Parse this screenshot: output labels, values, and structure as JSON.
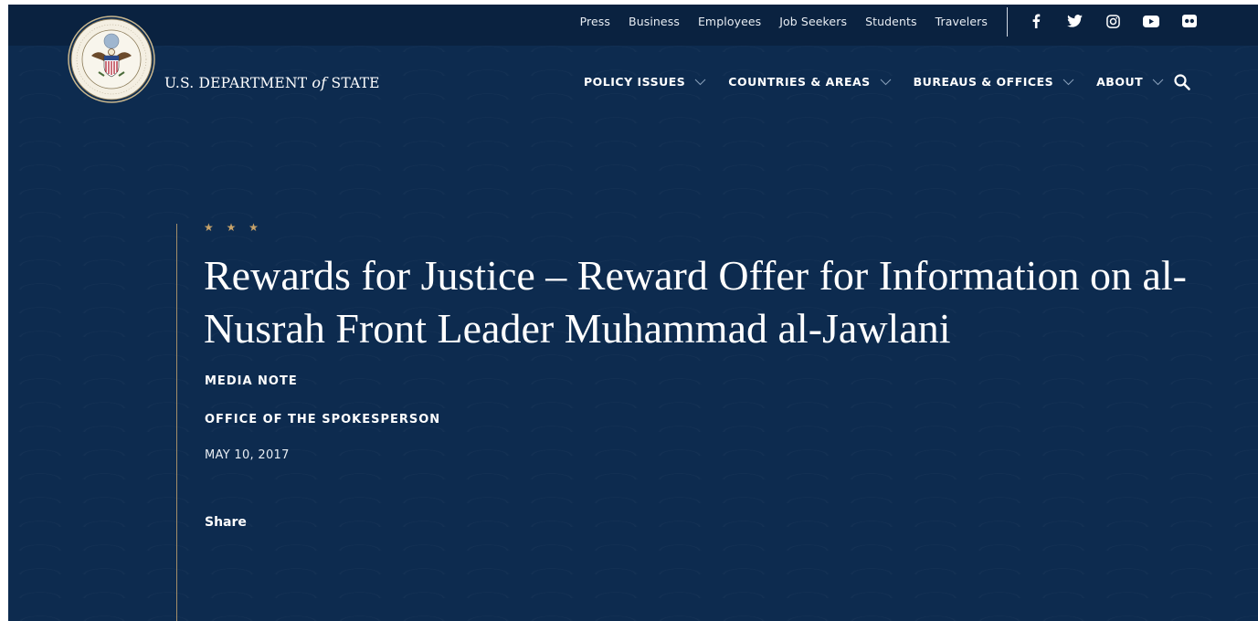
{
  "header": {
    "utility_links": [
      {
        "label": "Press"
      },
      {
        "label": "Business"
      },
      {
        "label": "Employees"
      },
      {
        "label": "Job Seekers"
      },
      {
        "label": "Students"
      },
      {
        "label": "Travelers"
      }
    ],
    "social_icons": [
      "facebook-icon",
      "twitter-icon",
      "instagram-icon",
      "youtube-icon",
      "flickr-icon"
    ],
    "seal_text": "DEPARTMENT OF STATE · UNITED STATES OF AMERICA",
    "wordmark": {
      "pre": "U.S. DEPARTMENT",
      "of": "of",
      "post": "STATE"
    },
    "nav": [
      {
        "label": "POLICY ISSUES"
      },
      {
        "label": "COUNTRIES & AREAS"
      },
      {
        "label": "BUREAUS & OFFICES"
      },
      {
        "label": "ABOUT"
      }
    ],
    "search_icon": "search-icon"
  },
  "article": {
    "stars": "★ ★ ★",
    "title": "Rewards for Justice – Reward Offer for Information on al-Nusrah Front Leader Muhammad al-Jawlani",
    "type": "MEDIA NOTE",
    "office": "OFFICE OF THE SPOKESPERSON",
    "date": "MAY 10, 2017",
    "share_label": "Share"
  },
  "colors": {
    "background": "#0d2b4f",
    "utility_bar": "#0a2240",
    "accent_gold": "#c7a36a",
    "text": "#ffffff"
  }
}
